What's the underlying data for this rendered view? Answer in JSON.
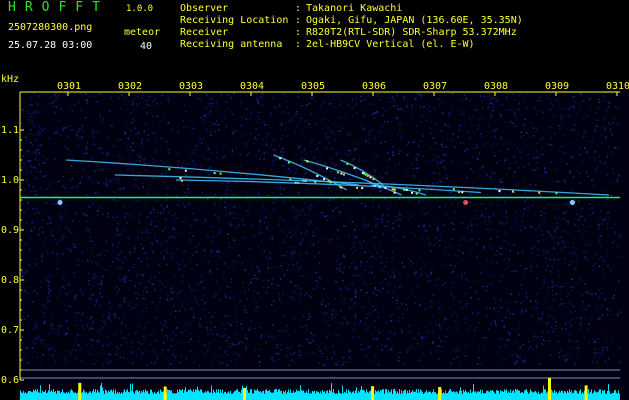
{
  "app": {
    "title": "HROFFT",
    "version": "1.0.0"
  },
  "file_name": "2507280300.png",
  "timestamp": "25.07.28 03:00",
  "meteor": {
    "label": "meteor",
    "count": "40"
  },
  "station": [
    {
      "label": "Observer",
      "value": "Takanori Kawachi"
    },
    {
      "label": "Receiving Location",
      "value": "Ogaki, Gifu, JAPAN (136.60E, 35.35N)"
    },
    {
      "label": "Receiver",
      "value": "R820T2(RTL-SDR) SDR-Sharp 53.372MHz"
    },
    {
      "label": "Receiving antenna",
      "value": "2el-HB9CV Vertical (el. E-W)"
    }
  ],
  "freq_axis": {
    "unit": "kHz",
    "ticks": [
      "1.1",
      "1.0",
      "0.9",
      "0.8",
      "0.7",
      "0.6"
    ],
    "range": [
      0.6,
      1.15
    ]
  },
  "time_axis": {
    "ticks": [
      "0301",
      "0302",
      "0303",
      "0304",
      "0305",
      "0306",
      "0307",
      "0308",
      "0309",
      "0310"
    ]
  },
  "colors": {
    "background": "#000000",
    "text_green": "#2fe02f",
    "text_yellow": "#ffff33",
    "noise": "#1a2a9a",
    "carrier": "#00ff66",
    "level_bars": "#00e5ff",
    "level_peaks": "#ffff00"
  },
  "carrier_freq_khz": 0.965,
  "meteor_trails": [
    {
      "t_start": 0.4,
      "f_start": 1.04,
      "t_end": 5.2,
      "f_end": 0.99
    },
    {
      "t_start": 1.2,
      "f_start": 1.01,
      "t_end": 9.3,
      "f_end": 0.97
    },
    {
      "t_start": 3.8,
      "f_start": 1.05,
      "t_end": 5.0,
      "f_end": 0.98
    },
    {
      "t_start": 4.3,
      "f_start": 1.04,
      "t_end": 5.9,
      "f_end": 0.97
    },
    {
      "t_start": 4.9,
      "f_start": 1.04,
      "t_end": 5.6,
      "f_end": 0.99
    },
    {
      "t_start": 5.4,
      "f_start": 0.99,
      "t_end": 6.3,
      "f_end": 0.97
    },
    {
      "t_start": 2.2,
      "f_start": 1.0,
      "t_end": 7.2,
      "f_end": 0.975
    }
  ],
  "meteor_heads": [
    {
      "t": 0.3,
      "f": 0.955
    },
    {
      "t": 6.95,
      "f": 0.955
    },
    {
      "t": 8.7,
      "f": 0.955
    }
  ]
}
